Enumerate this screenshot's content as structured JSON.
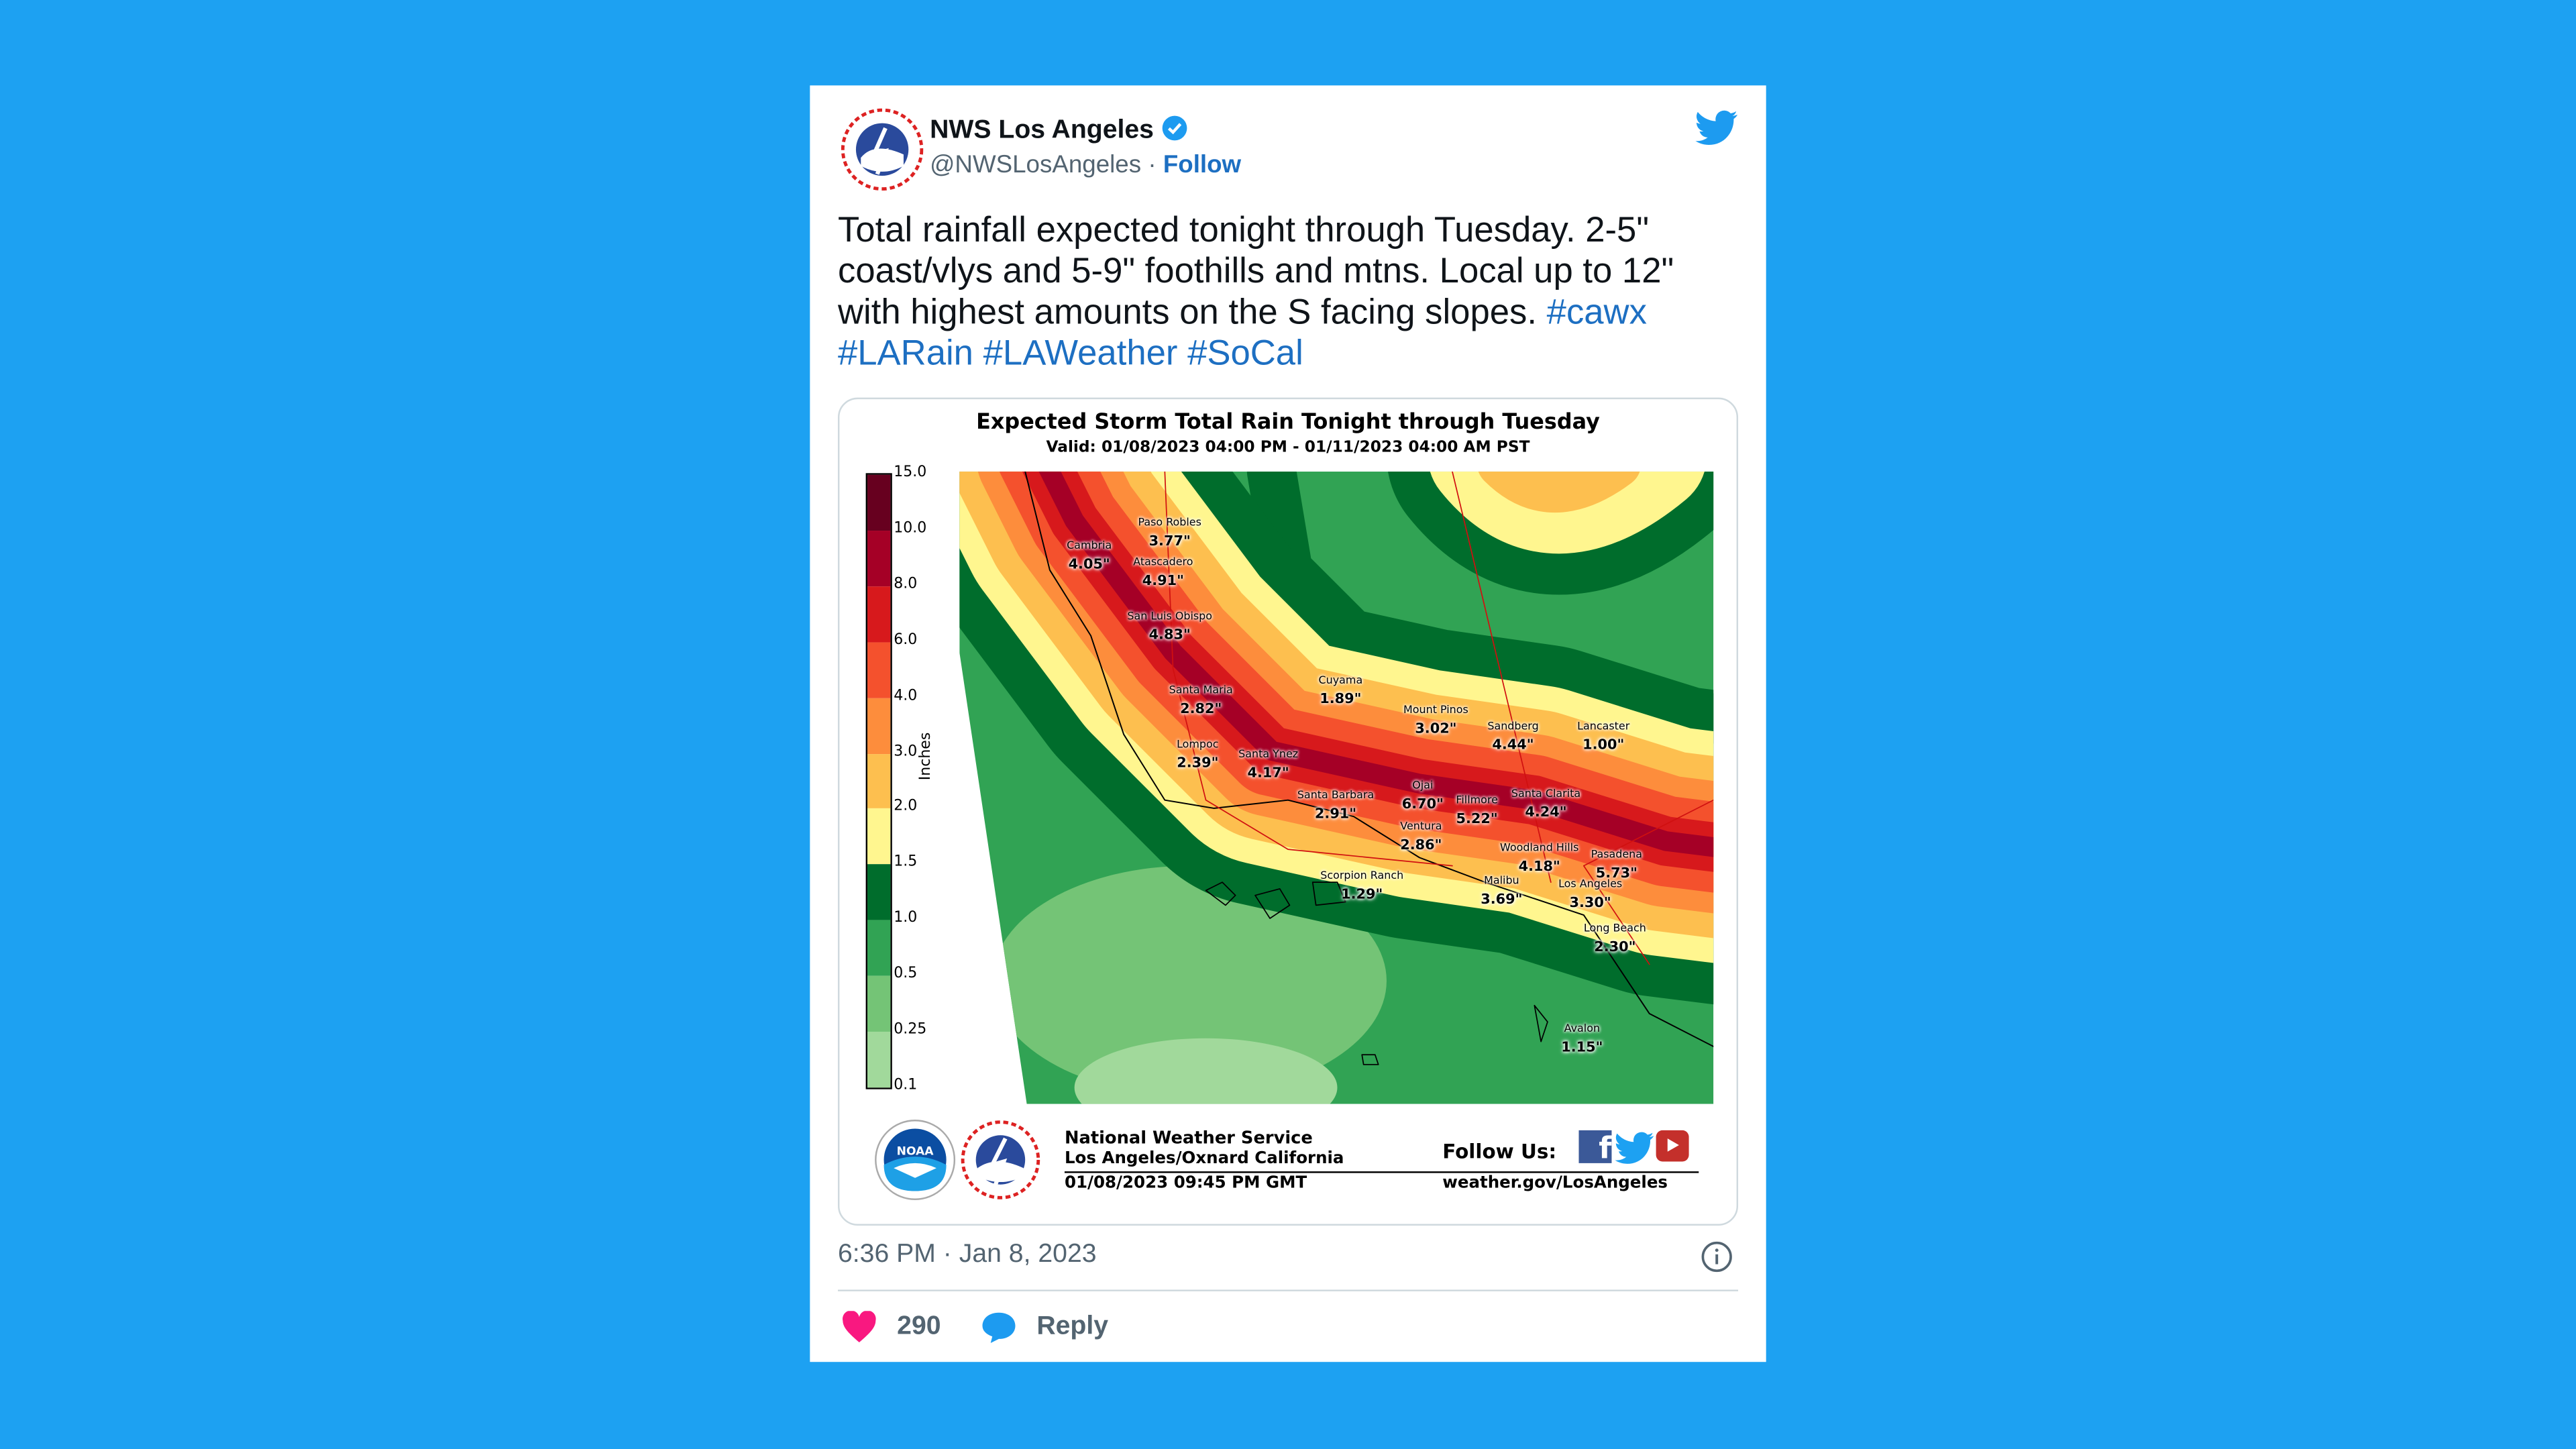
{
  "tweet": {
    "author_name": "NWS Los Angeles",
    "verified": true,
    "handle": "@NWSLosAngeles",
    "separator": "·",
    "follow_label": "Follow",
    "text_plain": "Total rainfall expected tonight through Tuesday. 2-5\" coast/vlys and 5-9\" foothills and mtns. Local up to 12\" with highest amounts on the S facing slopes.",
    "hashtags": [
      "#cawx",
      "#LARain",
      "#LAWeather",
      "#SoCal"
    ],
    "timestamp": "6:36 PM · Jan 8, 2023",
    "likes": "290",
    "reply_label": "Reply",
    "icons": {
      "brand": "twitter-bird-icon",
      "info": "info-icon",
      "like": "heart-icon",
      "reply": "speech-bubble-icon"
    },
    "colors": {
      "background": "#1DA1F2",
      "link": "#1d6fc2",
      "heart": "#f91880"
    }
  },
  "graphic": {
    "title": "Expected Storm Total Rain Tonight through Tuesday",
    "subtitle": "Valid: 01/08/2023 04:00 PM - 01/11/2023 04:00 AM PST",
    "colorbar_label": "Inches",
    "colorbar_ticks": [
      "15.0",
      "10.0",
      "8.0",
      "6.0",
      "4.0",
      "3.0",
      "2.0",
      "1.5",
      "1.0",
      "0.5",
      "0.25",
      "0.1"
    ],
    "colorbar_colors": [
      "#67001f",
      "#a50026",
      "#d7191c",
      "#f4512d",
      "#fd8d3c",
      "#fdbf4f",
      "#fff68f",
      "#006d2c",
      "#31a354",
      "#74c476",
      "#a1d99b"
    ],
    "cities": [
      {
        "name": "Paso Robles",
        "value": "3.77\""
      },
      {
        "name": "Cambria",
        "value": "4.05\""
      },
      {
        "name": "Atascadero",
        "value": "4.91\""
      },
      {
        "name": "San Luis Obispo",
        "value": "4.83\""
      },
      {
        "name": "Santa Maria",
        "value": "2.82\""
      },
      {
        "name": "Cuyama",
        "value": "1.89\""
      },
      {
        "name": "Mount Pinos",
        "value": "3.02\""
      },
      {
        "name": "Sandberg",
        "value": "4.44\""
      },
      {
        "name": "Lancaster",
        "value": "1.00\""
      },
      {
        "name": "Lompoc",
        "value": "2.39\""
      },
      {
        "name": "Santa Ynez",
        "value": "4.17\""
      },
      {
        "name": "Santa Barbara",
        "value": "2.91\""
      },
      {
        "name": "Ojai",
        "value": "6.70\""
      },
      {
        "name": "Fillmore",
        "value": "5.22\""
      },
      {
        "name": "Santa Clarita",
        "value": "4.24\""
      },
      {
        "name": "Ventura",
        "value": "2.86\""
      },
      {
        "name": "Woodland Hills",
        "value": "4.18\""
      },
      {
        "name": "Pasadena",
        "value": "5.73\""
      },
      {
        "name": "Malibu",
        "value": "3.69\""
      },
      {
        "name": "Los Angeles",
        "value": "3.30\""
      },
      {
        "name": "Scorpion Ranch",
        "value": "1.29\""
      },
      {
        "name": "Long Beach",
        "value": "2.30\""
      },
      {
        "name": "Avalon",
        "value": "1.15\""
      }
    ],
    "footer": {
      "org": "National Weather Service",
      "office": "Los Angeles/Oxnard California",
      "issued": "01/08/2023 09:45 PM GMT",
      "follow_us": "Follow Us:",
      "website": "weather.gov/LosAngeles",
      "noaa_logo_text": "NOAA"
    }
  }
}
